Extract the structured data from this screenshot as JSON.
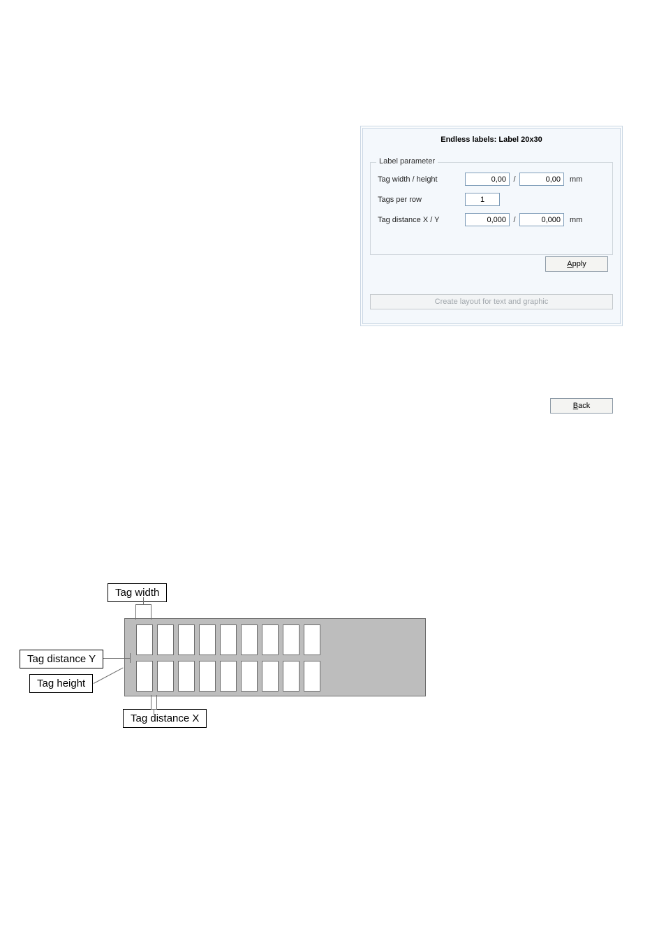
{
  "dialog": {
    "title": "Endless labels: Label 20x30",
    "fieldset_legend": "Label parameter",
    "rows": {
      "width_height": {
        "label": "Tag width / height",
        "val1": "0,00",
        "sep": "/",
        "val2": "0,00",
        "unit": "mm"
      },
      "tags_per_row": {
        "label": "Tags per row",
        "val1": "1"
      },
      "distance_xy": {
        "label": "Tag distance  X / Y",
        "val1": "0,000",
        "sep": "/",
        "val2": "0,000",
        "unit": "mm"
      }
    },
    "apply_label_pre": "",
    "apply_underline": "A",
    "apply_label_post": "pply",
    "create_layout_label": "Create layout for text and graphic",
    "back_underline": "B",
    "back_label_post": "ack"
  },
  "diagram": {
    "tag_width": "Tag width",
    "tag_dist_y": "Tag distance Y",
    "tag_height": "Tag height",
    "tag_dist_x": "Tag distance X"
  }
}
